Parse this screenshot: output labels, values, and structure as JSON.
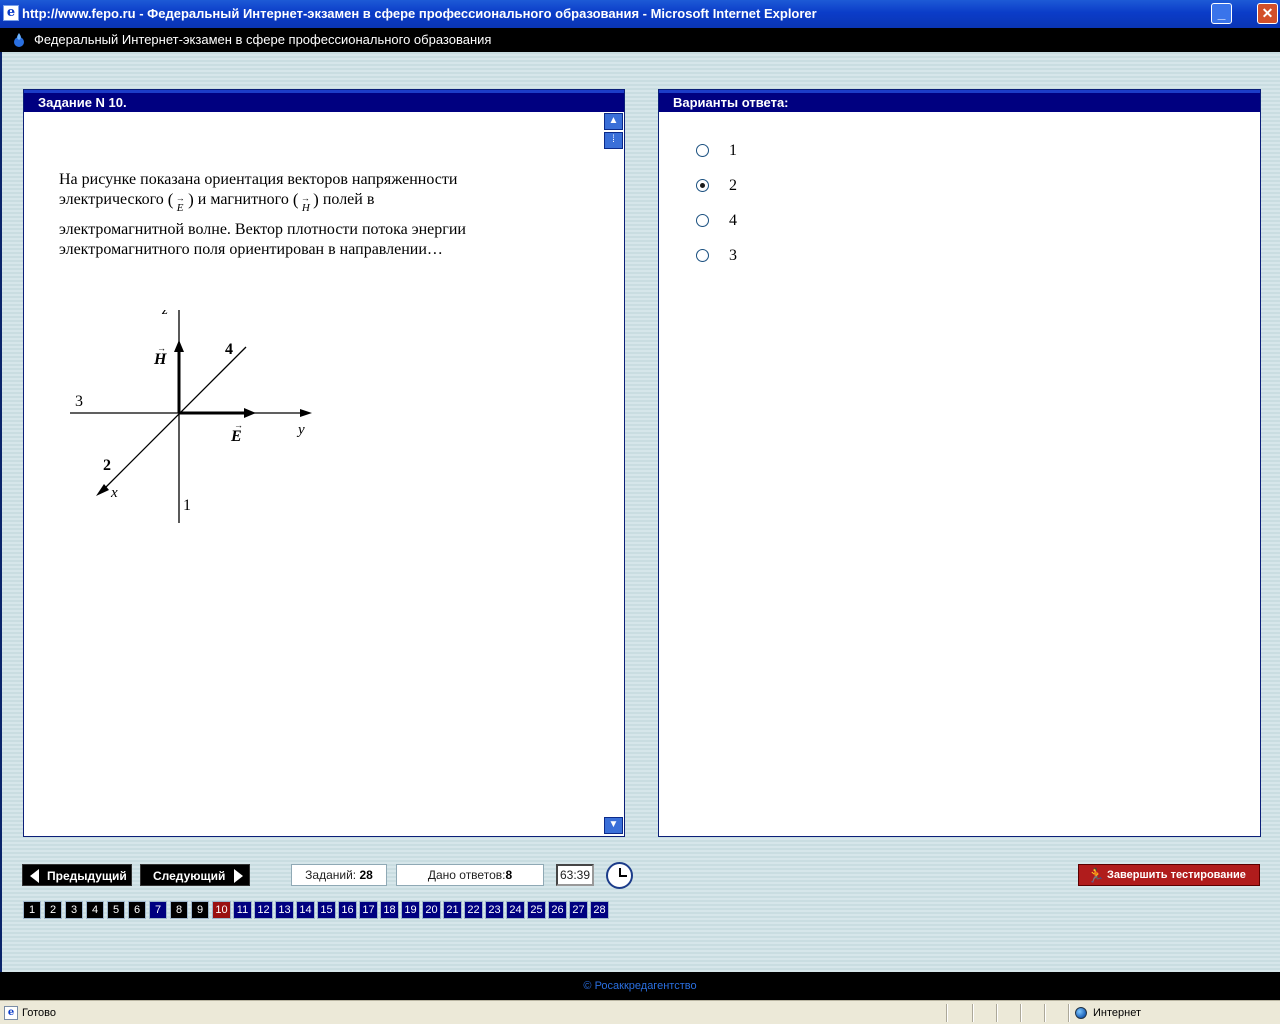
{
  "window": {
    "title": "http://www.fepo.ru - Федеральный Интернет-экзамен в сфере профессионального образования - Microsoft Internet Explorer",
    "min_glyph": "_",
    "close_glyph": "✕"
  },
  "app": {
    "header": "Федеральный Интернет-экзамен в сфере профессионального образования"
  },
  "question": {
    "title": "Задание N 10.",
    "lines": [
      "На рисунке показана ориентация векторов напряженности",
      "электрического",
      "и магнитного",
      "полей в",
      "электромагнитной волне. Вектор плотности потока энергии",
      "электромагнитного поля ориентирован в направлении…"
    ],
    "sym_E": "E",
    "sym_H": "H",
    "figure": {
      "axis_z": "z",
      "axis_y": "y",
      "axis_x": "x",
      "vec_H": "H",
      "vec_E": "E",
      "dir_1": "1",
      "dir_2": "2",
      "dir_3": "3",
      "dir_4": "4"
    }
  },
  "answers": {
    "title": "Варианты ответа:",
    "options": [
      {
        "label": "1",
        "checked": false
      },
      {
        "label": "2",
        "checked": true
      },
      {
        "label": "4",
        "checked": false
      },
      {
        "label": "3",
        "checked": false
      }
    ]
  },
  "nav": {
    "prev": "Предыдущий",
    "next": "Следующий",
    "tasks_label": "Заданий:",
    "tasks_value": "28",
    "answered_label": "Дано ответов:",
    "answered_value": "8",
    "timer": "63:39",
    "finish": "Завершить тестирование",
    "current_page": 10,
    "pages": [
      "1",
      "2",
      "3",
      "4",
      "5",
      "6",
      "7",
      "8",
      "9",
      "10",
      "11",
      "12",
      "13",
      "14",
      "15",
      "16",
      "17",
      "18",
      "19",
      "20",
      "21",
      "22",
      "23",
      "24",
      "25",
      "26",
      "27",
      "28"
    ]
  },
  "footer": {
    "copyright": "© Росаккредагентство"
  },
  "status": {
    "text": "Готово",
    "zone": "Интернет"
  }
}
